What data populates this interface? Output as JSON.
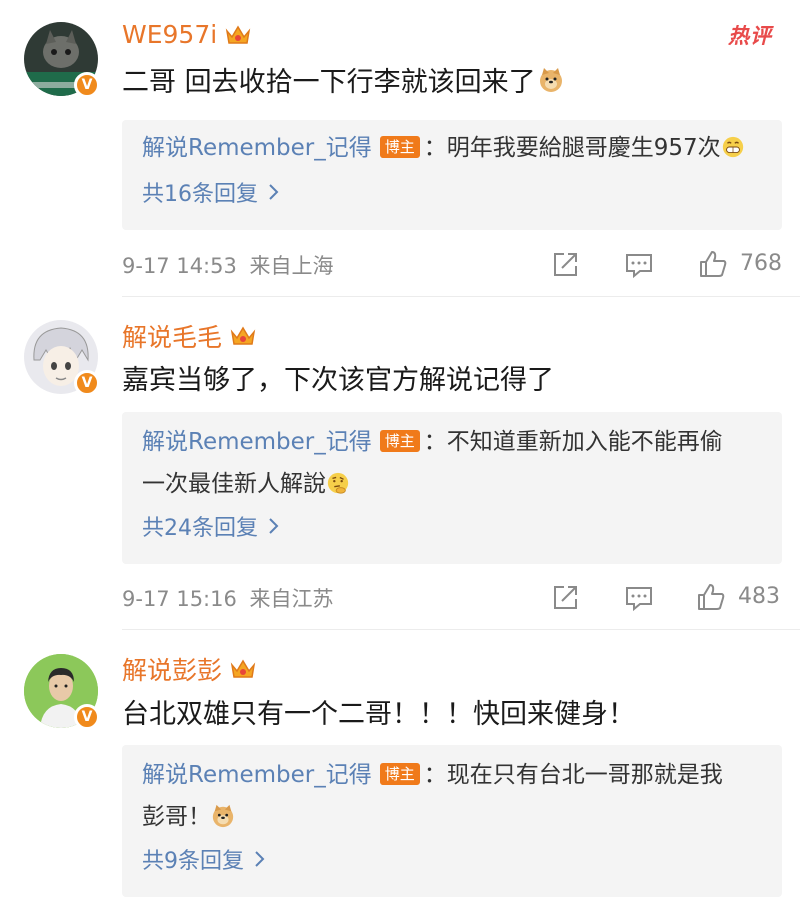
{
  "hot_badge": "热评",
  "comments": [
    {
      "username": "WE957i",
      "text": "二哥 回去收拾一下行李就该回来了",
      "emoji": "doge-emoji",
      "reply": {
        "author": "解说Remember_记得",
        "badge": "博主",
        "text": "：明年我要給腿哥慶生957次",
        "text2": "",
        "emoji": "grin-emoji"
      },
      "reply_count_label": "共16条回复",
      "time": "9-17 14:53",
      "location": "来自上海",
      "likes": "768"
    },
    {
      "username": "解说毛毛",
      "text": "嘉宾当够了，下次该官方解说记得了",
      "emoji": "",
      "reply": {
        "author": "解说Remember_记得",
        "badge": "博主",
        "text": "：不知道重新加入能不能再偷",
        "text2": "一次最佳新人解說",
        "emoji": "thinking-emoji"
      },
      "reply_count_label": "共24条回复",
      "time": "9-17 15:16",
      "location": "来自江苏",
      "likes": "483"
    },
    {
      "username": "解说彭彭",
      "text": "台北双雄只有一个二哥！！！快回来健身！",
      "emoji": "",
      "reply": {
        "author": "解说Remember_记得",
        "badge": "博主",
        "text": "：现在只有台北一哥那就是我",
        "text2": "彭哥！",
        "emoji": "doge-emoji"
      },
      "reply_count_label": "共9条回复",
      "time": "",
      "location": "",
      "likes": ""
    }
  ],
  "colors": {
    "username": "#e8762a",
    "reply_author": "#5b81b5",
    "badge_bg": "#f07a1a",
    "reply_bg": "#f4f4f4",
    "meta": "#8a8a8a",
    "hot": "#e84a4a"
  }
}
